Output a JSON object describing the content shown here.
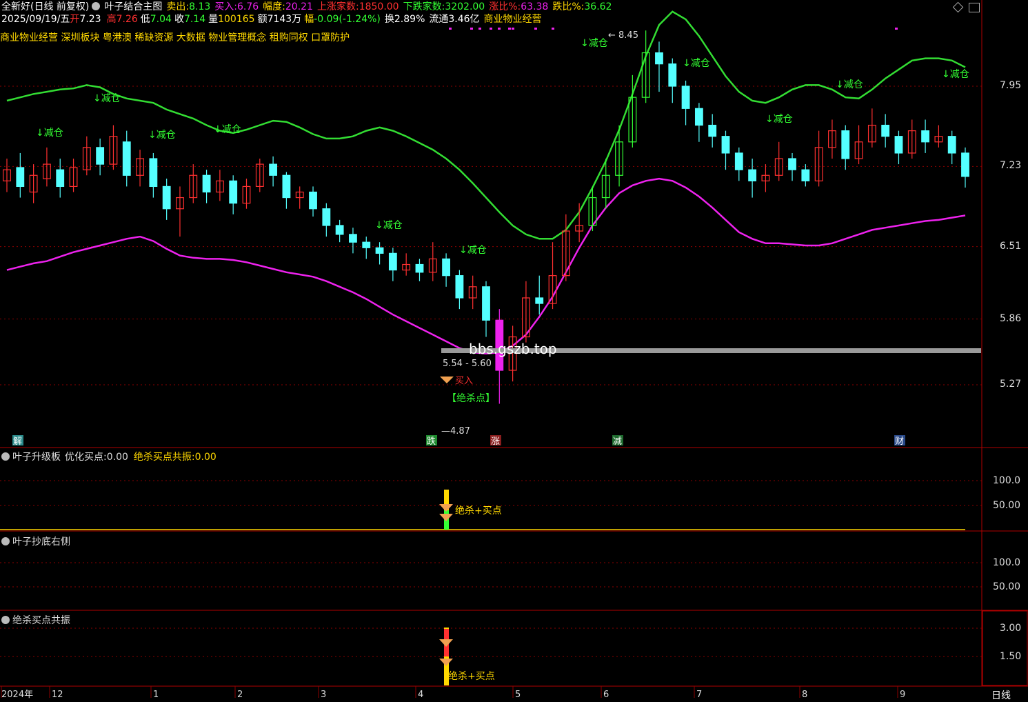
{
  "header": {
    "stock": "全新好(日线 前复权)",
    "indicator": "叶子结合主图",
    "sell_label": "卖出:",
    "sell_val": "8.13",
    "buy_label": "买入:",
    "buy_val": "6.76",
    "amp_label": "幅度:",
    "amp_val": "20.21",
    "up_label": "上涨家数:",
    "up_val": "1850.00",
    "down_label": "下跌家数:",
    "down_val": "3202.00",
    "upratio_label": "涨比%:",
    "upratio_val": "63.38",
    "downratio_label": "跌比%:",
    "downratio_val": "36.62"
  },
  "quote": {
    "date": "2025/09/19/五",
    "open_l": "开",
    "open": "7.23",
    "high_l": "高",
    "high": "7.26",
    "low_l": "低",
    "low": "7.04",
    "close_l": "收",
    "close": "7.14",
    "vol_l": "量",
    "vol": "100165",
    "amt_l": "额",
    "amt": "7143万",
    "chg_l": "幅",
    "chg": "-0.09(-1.24%)",
    "turn_l": "换",
    "turn": "2.89%",
    "float_l": "流通",
    "float": "3.46亿",
    "industry": "商业物业经营"
  },
  "concepts": "商业物业经营 深圳板块 粤港澳 稀缺资源 大数据 物业管理概念 租购同权 口罩防护",
  "chart_data": {
    "type": "candlestick",
    "y_ticks": [
      "7.95",
      "7.23",
      "6.51",
      "5.86",
      "5.27"
    ],
    "y_tick_values": [
      7.95,
      7.23,
      6.51,
      5.86,
      5.27
    ],
    "x_ticks": [
      "2024年",
      "12",
      "1",
      "2",
      "3",
      "4",
      "5",
      "6",
      "7",
      "8",
      "9"
    ],
    "high_annot": "8.45",
    "low_annot": "4.87",
    "range_annot": "5.54 - 5.60",
    "watermark_text": "bbs.gszb.top",
    "reduce_label": "↓减仓",
    "buy_label": "买入",
    "kill_label": "【绝杀点】",
    "event_markers": [
      "解",
      "跌",
      "涨",
      "减",
      "财"
    ],
    "upper_band": [
      7.82,
      7.85,
      7.88,
      7.9,
      7.92,
      7.93,
      7.96,
      7.94,
      7.88,
      7.84,
      7.82,
      7.8,
      7.74,
      7.7,
      7.66,
      7.6,
      7.55,
      7.53,
      7.56,
      7.6,
      7.64,
      7.63,
      7.58,
      7.52,
      7.48,
      7.48,
      7.5,
      7.55,
      7.58,
      7.55,
      7.5,
      7.44,
      7.38,
      7.3,
      7.2,
      7.08,
      6.95,
      6.82,
      6.7,
      6.62,
      6.58,
      6.58,
      6.66,
      6.82,
      7.04,
      7.28,
      7.56,
      7.88,
      8.22,
      8.5,
      8.62,
      8.55,
      8.4,
      8.22,
      8.04,
      7.9,
      7.82,
      7.8,
      7.85,
      7.92,
      7.96,
      7.96,
      7.92,
      7.85,
      7.84,
      7.92,
      8.02,
      8.1,
      8.18,
      8.2,
      8.2,
      8.18,
      8.12
    ],
    "lower_band": [
      6.3,
      6.33,
      6.36,
      6.38,
      6.42,
      6.46,
      6.49,
      6.52,
      6.55,
      6.58,
      6.6,
      6.56,
      6.49,
      6.43,
      6.41,
      6.4,
      6.4,
      6.39,
      6.37,
      6.34,
      6.31,
      6.28,
      6.26,
      6.24,
      6.2,
      6.15,
      6.1,
      6.04,
      5.97,
      5.9,
      5.84,
      5.78,
      5.72,
      5.66,
      5.6,
      5.56,
      5.55,
      5.56,
      5.62,
      5.72,
      5.88,
      6.06,
      6.28,
      6.5,
      6.7,
      6.86,
      6.99,
      7.06,
      7.1,
      7.12,
      7.1,
      7.04,
      6.96,
      6.86,
      6.75,
      6.64,
      6.58,
      6.54,
      6.54,
      6.53,
      6.52,
      6.52,
      6.54,
      6.58,
      6.62,
      6.66,
      6.68,
      6.7,
      6.72,
      6.74,
      6.75,
      6.77,
      6.79
    ],
    "candles": [
      [
        7.1,
        7.2,
        7.3,
        7.0
      ],
      [
        7.22,
        7.05,
        7.35,
        6.95
      ],
      [
        7.0,
        7.15,
        7.25,
        6.9
      ],
      [
        7.12,
        7.25,
        7.4,
        7.05
      ],
      [
        7.2,
        7.05,
        7.3,
        6.95
      ],
      [
        7.05,
        7.22,
        7.3,
        7.0
      ],
      [
        7.2,
        7.4,
        7.5,
        7.15
      ],
      [
        7.4,
        7.25,
        7.48,
        7.15
      ],
      [
        7.25,
        7.5,
        7.6,
        7.2
      ],
      [
        7.45,
        7.15,
        7.55,
        7.05
      ],
      [
        7.15,
        7.3,
        7.38,
        7.05
      ],
      [
        7.3,
        7.05,
        7.35,
        6.95
      ],
      [
        7.05,
        6.85,
        7.12,
        6.75
      ],
      [
        6.85,
        6.95,
        7.05,
        6.6
      ],
      [
        6.95,
        7.15,
        7.25,
        6.9
      ],
      [
        7.15,
        7.0,
        7.2,
        6.9
      ],
      [
        7.0,
        7.1,
        7.2,
        6.92
      ],
      [
        7.1,
        6.9,
        7.15,
        6.8
      ],
      [
        6.9,
        7.05,
        7.12,
        6.85
      ],
      [
        7.05,
        7.25,
        7.3,
        7.0
      ],
      [
        7.25,
        7.15,
        7.32,
        7.05
      ],
      [
        7.15,
        6.95,
        7.18,
        6.85
      ],
      [
        6.95,
        7.0,
        7.05,
        6.85
      ],
      [
        7.0,
        6.85,
        7.05,
        6.78
      ],
      [
        6.85,
        6.7,
        6.9,
        6.6
      ],
      [
        6.7,
        6.62,
        6.75,
        6.55
      ],
      [
        6.62,
        6.55,
        6.68,
        6.45
      ],
      [
        6.55,
        6.5,
        6.6,
        6.4
      ],
      [
        6.5,
        6.45,
        6.55,
        6.35
      ],
      [
        6.45,
        6.3,
        6.5,
        6.2
      ],
      [
        6.3,
        6.35,
        6.45,
        6.25
      ],
      [
        6.35,
        6.28,
        6.4,
        6.2
      ],
      [
        6.28,
        6.4,
        6.55,
        6.2
      ],
      [
        6.4,
        6.25,
        6.45,
        6.15
      ],
      [
        6.25,
        6.05,
        6.3,
        5.95
      ],
      [
        6.05,
        6.15,
        6.25,
        5.95
      ],
      [
        6.15,
        5.85,
        6.2,
        5.7
      ],
      [
        5.85,
        5.4,
        5.95,
        5.1
      ],
      [
        5.4,
        5.7,
        5.8,
        5.3
      ],
      [
        5.7,
        6.05,
        6.2,
        5.65
      ],
      [
        6.05,
        6.0,
        6.25,
        5.9
      ],
      [
        6.0,
        6.25,
        6.55,
        5.95
      ],
      [
        6.25,
        6.65,
        6.8,
        6.2
      ],
      [
        6.65,
        6.7,
        6.9,
        6.55
      ],
      [
        6.7,
        6.95,
        7.05,
        6.65
      ],
      [
        6.95,
        7.15,
        7.3,
        6.85
      ],
      [
        7.15,
        7.45,
        7.6,
        7.05
      ],
      [
        7.45,
        7.85,
        8.05,
        7.4
      ],
      [
        7.85,
        8.25,
        8.45,
        7.8
      ],
      [
        8.25,
        8.15,
        8.35,
        7.9
      ],
      [
        8.15,
        7.95,
        8.2,
        7.8
      ],
      [
        7.95,
        7.75,
        8.0,
        7.6
      ],
      [
        7.75,
        7.6,
        7.8,
        7.45
      ],
      [
        7.6,
        7.5,
        7.7,
        7.4
      ],
      [
        7.5,
        7.35,
        7.55,
        7.2
      ],
      [
        7.35,
        7.2,
        7.4,
        7.1
      ],
      [
        7.2,
        7.1,
        7.3,
        6.95
      ],
      [
        7.1,
        7.15,
        7.25,
        7.0
      ],
      [
        7.15,
        7.3,
        7.45,
        7.1
      ],
      [
        7.3,
        7.2,
        7.35,
        7.1
      ],
      [
        7.2,
        7.1,
        7.25,
        7.05
      ],
      [
        7.1,
        7.4,
        7.55,
        7.05
      ],
      [
        7.4,
        7.55,
        7.65,
        7.3
      ],
      [
        7.55,
        7.3,
        7.6,
        7.2
      ],
      [
        7.3,
        7.45,
        7.6,
        7.25
      ],
      [
        7.45,
        7.6,
        7.75,
        7.4
      ],
      [
        7.6,
        7.5,
        7.7,
        7.4
      ],
      [
        7.5,
        7.35,
        7.55,
        7.25
      ],
      [
        7.35,
        7.55,
        7.65,
        7.3
      ],
      [
        7.55,
        7.45,
        7.65,
        7.35
      ],
      [
        7.45,
        7.5,
        7.6,
        7.4
      ],
      [
        7.5,
        7.35,
        7.55,
        7.25
      ],
      [
        7.35,
        7.14,
        7.4,
        7.04
      ]
    ]
  },
  "panel2": {
    "title": "叶子升级板",
    "item1_label": "优化买点:",
    "item1_val": "0.00",
    "item2_label": "绝杀买点共振:",
    "item2_val": "0.00",
    "y_ticks": [
      "100.0",
      "50.00"
    ],
    "signal_label": "绝杀+买点"
  },
  "panel3": {
    "title": "叶子抄底右侧",
    "y_ticks": [
      "100.0",
      "50.00"
    ]
  },
  "panel4": {
    "title": "绝杀买点共振",
    "y_ticks": [
      "3.00",
      "1.50"
    ],
    "signal_label": "绝杀+买点"
  },
  "bottom_tab": "日线",
  "colors": {
    "grid": "#8b0000",
    "up": "#ff3030",
    "down": "#54ffff",
    "upper": "#33dd33",
    "lower": "#ee22ee",
    "text_yellow": "#ffd800",
    "green_text": "#33ff33"
  }
}
